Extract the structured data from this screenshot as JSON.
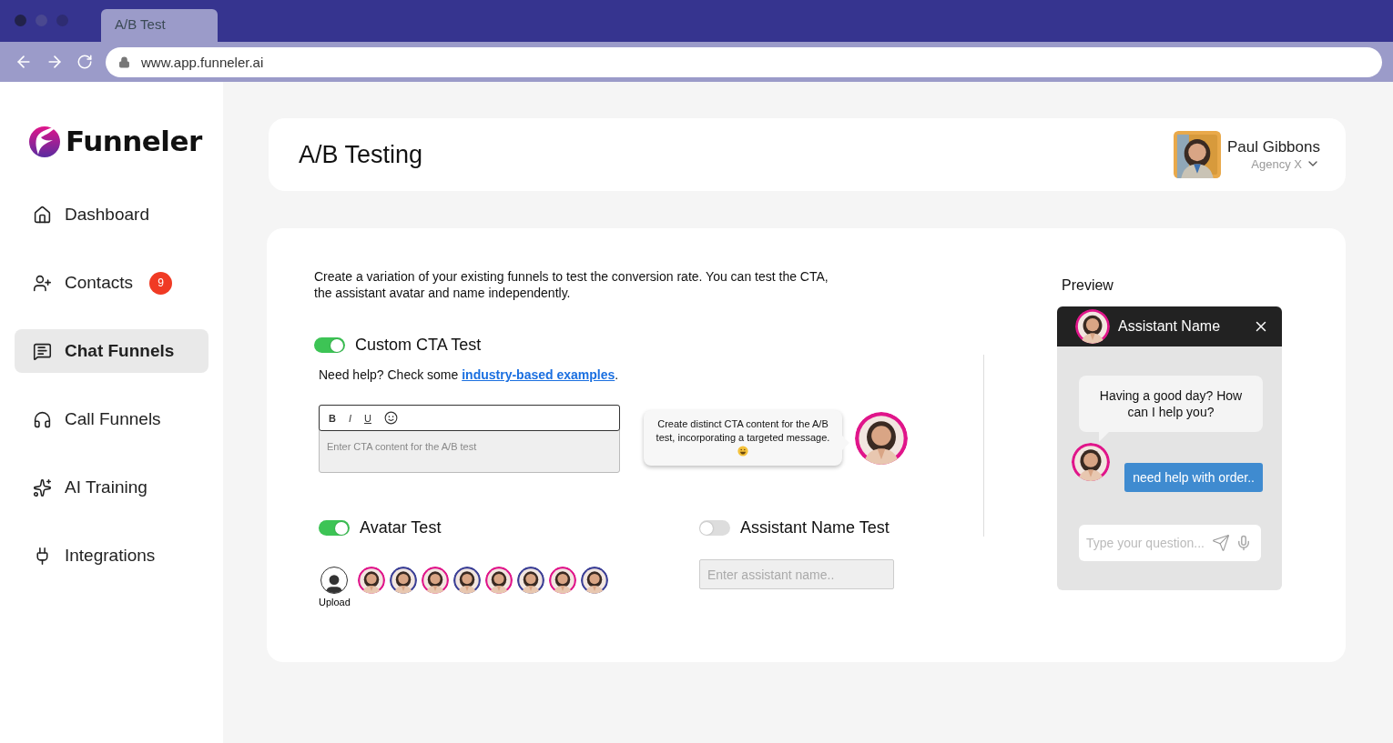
{
  "browser": {
    "tab": {
      "label": "A/B Test",
      "selected": true
    },
    "url": "www.app.funneler.ai"
  },
  "sidebar": {
    "logo": "Funneler",
    "items": [
      {
        "label": "Dashboard",
        "selected": false
      },
      {
        "label": "Contacts",
        "selected": false,
        "badge": "9"
      },
      {
        "label": "Chat Funnels",
        "selected": true
      },
      {
        "label": "Call Funnels",
        "selected": false
      },
      {
        "label": "AI Training",
        "selected": false
      },
      {
        "label": "Integrations",
        "selected": false
      }
    ]
  },
  "header": {
    "title": "A/B Testing",
    "user": {
      "name": "Paul Gibbons",
      "company": "Agency X"
    }
  },
  "intro": "Create a variation of your existing funnels to test the conversion rate. You can  test the CTA, the assistant avatar and name independently.",
  "cta_test": {
    "label": "Custom CTA Test",
    "on": true,
    "help": "Need help? Check some",
    "help_link": "industry-based examples",
    "help_end": ".",
    "format_buttons": [
      "B",
      "I",
      "U"
    ],
    "placeholder": "Enter CTA content for the A/B test",
    "tip": "Create distinct CTA content for the A/B test, incorporating a targeted message."
  },
  "avatar_test": {
    "label": "Avatar Test",
    "on": true,
    "upload": "Upload"
  },
  "name_test": {
    "label": "Assistant Name Test",
    "on": false,
    "placeholder": "Enter assistant name.."
  },
  "preview": {
    "title": "Preview",
    "assistant": "Assistant Name",
    "bot_message": "Having a good day? How can I help you?",
    "user_message": "need help with order..",
    "placeholder": "Type your question..."
  }
}
